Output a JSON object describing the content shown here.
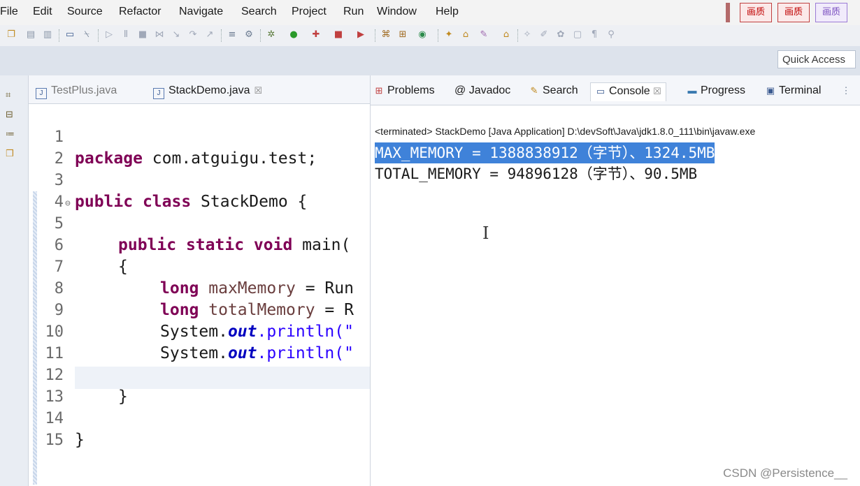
{
  "menubar": {
    "items": [
      "File",
      "Edit",
      "Source",
      "Refactor",
      "Navigate",
      "Search",
      "Project",
      "Run",
      "Window",
      "Help"
    ],
    "badges": [
      "画质",
      "画质",
      "画质"
    ]
  },
  "toolbar": {
    "quick_access": "Quick Access"
  },
  "editor": {
    "tabs": [
      {
        "label": "TestPlus.java"
      },
      {
        "label": "StackDemo.java",
        "close": "☒"
      }
    ],
    "lines": [
      {
        "n": "1"
      },
      {
        "n": "2"
      },
      {
        "n": "3"
      },
      {
        "n": "4"
      },
      {
        "n": "5"
      },
      {
        "n": "6"
      },
      {
        "n": "7"
      },
      {
        "n": "8"
      },
      {
        "n": "9"
      },
      {
        "n": "10"
      },
      {
        "n": "11"
      },
      {
        "n": "12"
      },
      {
        "n": "13"
      },
      {
        "n": "14"
      },
      {
        "n": "15"
      }
    ],
    "code": {
      "l1_kw": "package",
      "l1_rest": " com.atguigu.test;",
      "l3_kw1": "public",
      "l3_kw2": "class",
      "l3_rest": " StackDemo {",
      "l5_kw1": "public",
      "l5_kw2": "static",
      "l5_kw3": "void",
      "l5_rest": " main(",
      "l6": "{",
      "l7_kw": "long",
      "l7_var": "maxMemory",
      "l7_rest": " = Run",
      "l8_kw": "long",
      "l8_var": "totalMemory",
      "l8_rest": " = R",
      "l9_a": "System.",
      "l9_fld": "out",
      "l9_b": ".println(\"",
      "l10_a": "System.",
      "l10_fld": "out",
      "l10_b": ".println(\"",
      "l12": "}",
      "l14": "}"
    }
  },
  "console": {
    "tabs": [
      "Problems",
      "@ Javadoc",
      "Search",
      "Console",
      "Progress",
      "Terminal"
    ],
    "console_close": "☒",
    "terminated": "<terminated> StackDemo [Java Application] D:\\devSoft\\Java\\jdk1.8.0_111\\bin\\javaw.exe",
    "output": [
      "MAX_MEMORY = 1388838912（字节）、1324.5MB",
      "TOTAL_MEMORY = 94896128（字节）、90.5MB"
    ]
  },
  "watermark": "CSDN @Persistence__",
  "colors": {
    "keyword": "#7f0055",
    "field": "#0000c0",
    "selection": "#3f82d9"
  }
}
